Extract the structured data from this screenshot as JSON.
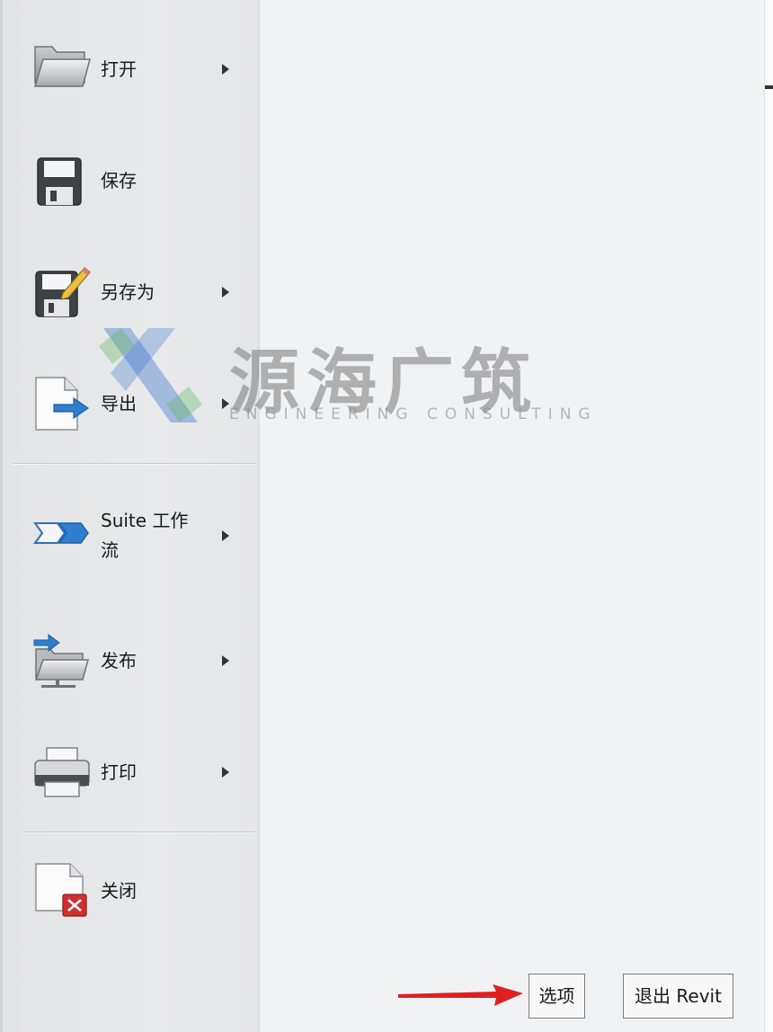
{
  "menu": {
    "items": [
      {
        "label": "打开",
        "icon": "folder-open-icon",
        "has_submenu": true
      },
      {
        "label": "保存",
        "icon": "floppy-disk-icon",
        "has_submenu": false
      },
      {
        "label": "另存为",
        "icon": "save-as-icon",
        "has_submenu": true
      },
      {
        "label": "导出",
        "icon": "export-icon",
        "has_submenu": true
      },
      {
        "label_line1": "Suite 工作",
        "label_line2": "流",
        "icon": "suite-workflow-icon",
        "has_submenu": true
      },
      {
        "label": "发布",
        "icon": "publish-icon",
        "has_submenu": true
      },
      {
        "label": "打印",
        "icon": "printer-icon",
        "has_submenu": true
      },
      {
        "label": "关闭",
        "icon": "close-document-icon",
        "has_submenu": false
      }
    ]
  },
  "footer": {
    "options_label": "选项",
    "exit_label": "退出 Revit"
  },
  "watermark": {
    "title": "源海广筑",
    "subtitle": "ENGINEERING CONSULTING"
  },
  "colors": {
    "annotation_arrow": "#e02020",
    "accent_blue": "#2f7fd0",
    "close_red": "#d03030"
  }
}
